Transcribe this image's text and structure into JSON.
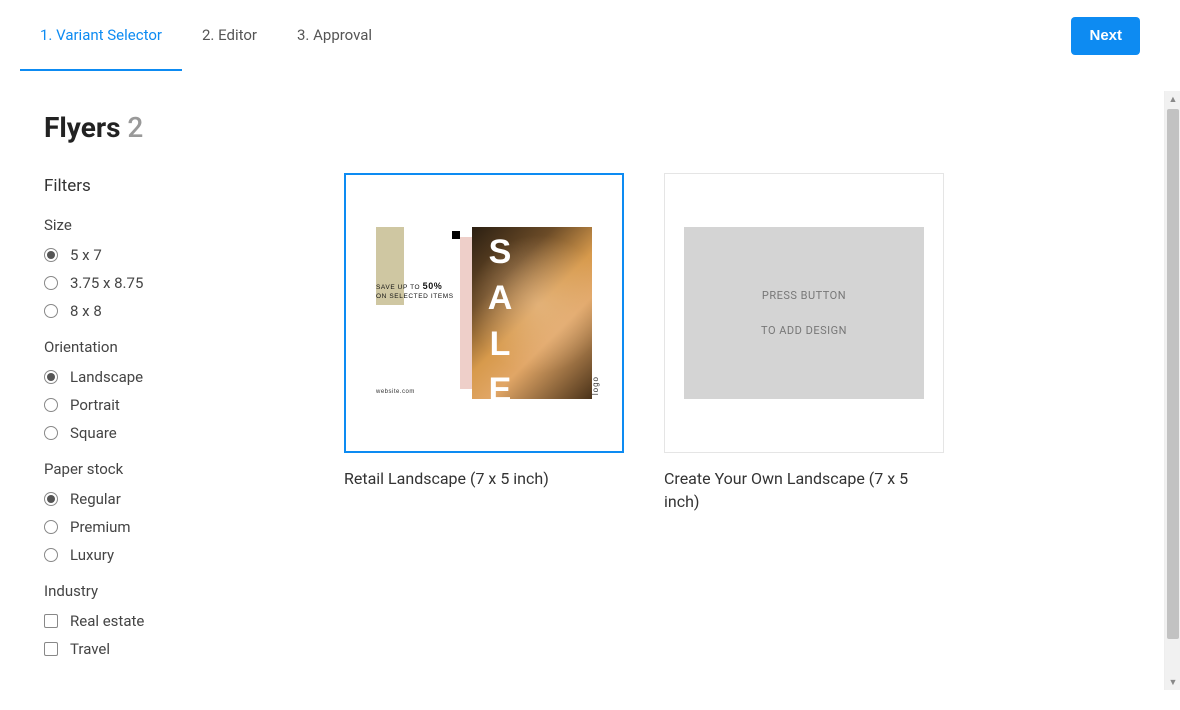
{
  "steps": [
    {
      "label": "1. Variant Selector",
      "active": true
    },
    {
      "label": "2. Editor",
      "active": false
    },
    {
      "label": "3. Approval",
      "active": false
    }
  ],
  "next_button": "Next",
  "page": {
    "title": "Flyers",
    "count": "2"
  },
  "filters": {
    "title": "Filters",
    "groups": [
      {
        "title": "Size",
        "type": "radio",
        "options": [
          {
            "label": "5 x 7",
            "checked": true
          },
          {
            "label": "3.75 x 8.75",
            "checked": false
          },
          {
            "label": "8 x 8",
            "checked": false
          }
        ]
      },
      {
        "title": "Orientation",
        "type": "radio",
        "options": [
          {
            "label": "Landscape",
            "checked": true
          },
          {
            "label": "Portrait",
            "checked": false
          },
          {
            "label": "Square",
            "checked": false
          }
        ]
      },
      {
        "title": "Paper stock",
        "type": "radio",
        "options": [
          {
            "label": "Regular",
            "checked": true
          },
          {
            "label": "Premium",
            "checked": false
          },
          {
            "label": "Luxury",
            "checked": false
          }
        ]
      },
      {
        "title": "Industry",
        "type": "checkbox",
        "options": [
          {
            "label": "Real estate",
            "checked": false
          },
          {
            "label": "Travel",
            "checked": false
          }
        ]
      }
    ]
  },
  "templates": [
    {
      "label": "Retail Landscape (7 x 5 inch)",
      "selected": true,
      "kind": "retail"
    },
    {
      "label": "Create Your Own Landscape (7 x 5 inch)",
      "selected": false,
      "kind": "placeholder"
    }
  ],
  "retail_flyer": {
    "save_line1": "SAVE UP TO ",
    "save_pct": "50%",
    "save_line2": "ON SELECTED ITEMS",
    "website": "website.com",
    "sale_word": "SALE",
    "logo": "logo"
  },
  "placeholder": {
    "line1": "PRESS BUTTON",
    "line2": "TO ADD DESIGN"
  }
}
